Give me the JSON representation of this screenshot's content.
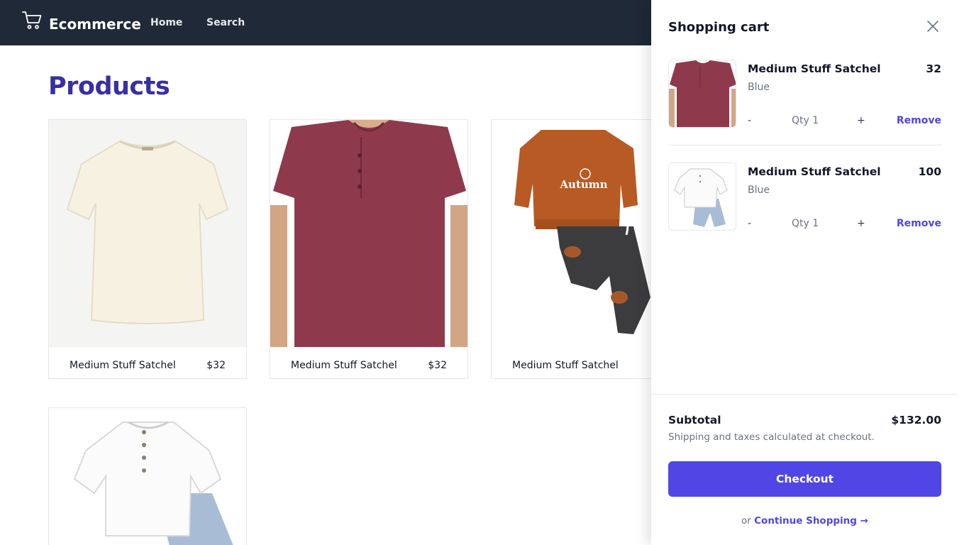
{
  "header": {
    "logo_text": "Ecommerce",
    "logo_icon": "cart-icon",
    "nav": [
      "Home",
      "Search"
    ]
  },
  "page": {
    "title": "Products"
  },
  "products": [
    {
      "name": "Medium Stuff Satchel",
      "price": "$32",
      "image": "cream-tshirt"
    },
    {
      "name": "Medium Stuff Satchel",
      "price": "$32",
      "image": "maroon-henley-tshirt"
    },
    {
      "name": "Medium Stuff Satchel",
      "price": "",
      "image": "autumn-sweatshirt-set"
    },
    {
      "name": "",
      "price": "",
      "image": "white-linen-shirt-set"
    }
  ],
  "cart": {
    "title": "Shopping cart",
    "close_icon": "close-icon",
    "items": [
      {
        "name": "Medium Stuff Satchel",
        "price": "32",
        "variant": "Blue",
        "minus": "-",
        "qty": "Qty 1",
        "plus": "+",
        "remove": "Remove",
        "image": "maroon-henley-tshirt"
      },
      {
        "name": "Medium Stuff Satchel",
        "price": "100",
        "variant": "Blue",
        "minus": "-",
        "qty": "Qty 1",
        "plus": "+",
        "remove": "Remove",
        "image": "white-linen-shirt-set"
      }
    ],
    "subtotal_label": "Subtotal",
    "subtotal_value": "$132.00",
    "shipping_note": "Shipping and taxes calculated at checkout.",
    "checkout_label": "Checkout",
    "continue_prefix": "or",
    "continue_label": "Continue Shopping →"
  },
  "colors": {
    "header_bg": "#1f2937",
    "title": "#3730a3",
    "accent": "#4f46e5"
  }
}
